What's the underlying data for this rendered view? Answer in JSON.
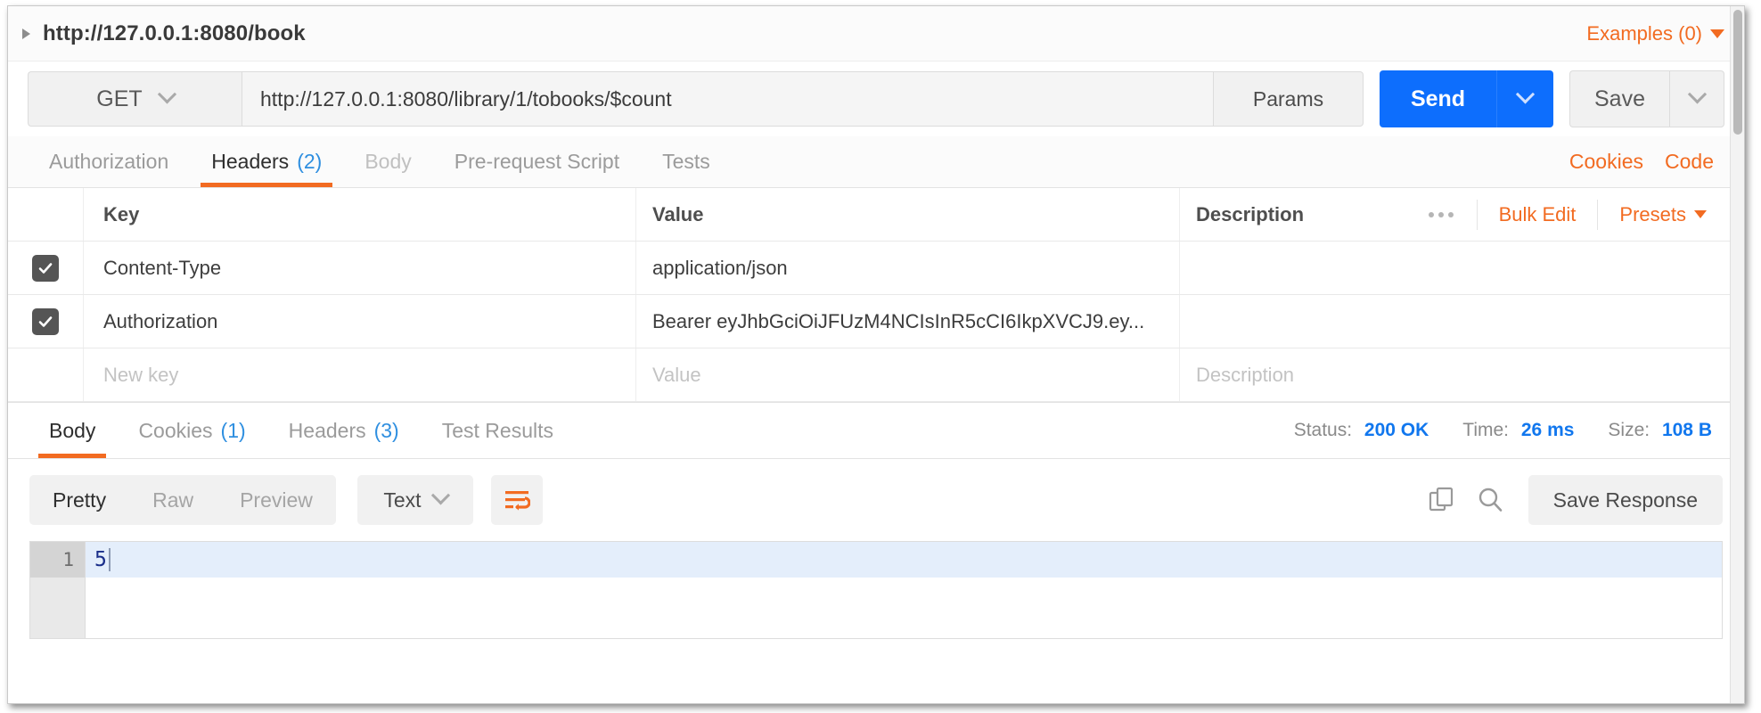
{
  "request": {
    "breadcrumb": "http://127.0.0.1:8080/book",
    "expand_icon": "triangle-right-icon",
    "examples_label": "Examples (0)",
    "method": "GET",
    "url": "http://127.0.0.1:8080/library/1/tobooks/$count",
    "params_label": "Params",
    "send_label": "Send",
    "save_label": "Save"
  },
  "request_tabs": [
    {
      "label": "Authorization",
      "count": "",
      "active": false,
      "dim": false
    },
    {
      "label": "Headers",
      "count": "(2)",
      "active": true,
      "dim": false
    },
    {
      "label": "Body",
      "count": "",
      "active": false,
      "dim": true
    },
    {
      "label": "Pre-request Script",
      "count": "",
      "active": false,
      "dim": false
    },
    {
      "label": "Tests",
      "count": "",
      "active": false,
      "dim": false
    }
  ],
  "request_tabs_right": [
    {
      "label": "Cookies"
    },
    {
      "label": "Code"
    }
  ],
  "headers_table": {
    "columns": {
      "key": "Key",
      "value": "Value",
      "description": "Description"
    },
    "actions": {
      "more": "more-options",
      "bulk_edit": "Bulk Edit",
      "presets": "Presets"
    },
    "rows": [
      {
        "checked": true,
        "key": "Content-Type",
        "value": "application/json",
        "description": ""
      },
      {
        "checked": true,
        "key": "Authorization",
        "value": "Bearer eyJhbGciOiJFUzM4NCIsInR5cCI6IkpXVCJ9.ey...",
        "description": ""
      }
    ],
    "new_row": {
      "key_placeholder": "New key",
      "value_placeholder": "Value",
      "description_placeholder": "Description"
    }
  },
  "response_tabs": [
    {
      "label": "Body",
      "count": "",
      "active": true
    },
    {
      "label": "Cookies",
      "count": "(1)",
      "active": false
    },
    {
      "label": "Headers",
      "count": "(3)",
      "active": false
    },
    {
      "label": "Test Results",
      "count": "",
      "active": false
    }
  ],
  "response_meta": {
    "status_label": "Status:",
    "status_value": "200 OK",
    "time_label": "Time:",
    "time_value": "26 ms",
    "size_label": "Size:",
    "size_value": "108 B"
  },
  "response_toolbar": {
    "views": [
      {
        "label": "Pretty",
        "active": true
      },
      {
        "label": "Raw",
        "active": false
      },
      {
        "label": "Preview",
        "active": false
      }
    ],
    "format": "Text",
    "wrap_icon": "word-wrap-icon",
    "copy_icon": "copy-icon",
    "search_icon": "search-icon",
    "save_response_label": "Save Response"
  },
  "response_body": {
    "lines": [
      {
        "number": "1",
        "content": "5"
      }
    ]
  },
  "colors": {
    "accent_orange": "#f26b21",
    "send_blue": "#0d6efd",
    "meta_blue": "#1177ee",
    "count_blue": "#2f8fe0",
    "checkbox_gray": "#555555",
    "code_text": "#1a2e8a"
  }
}
